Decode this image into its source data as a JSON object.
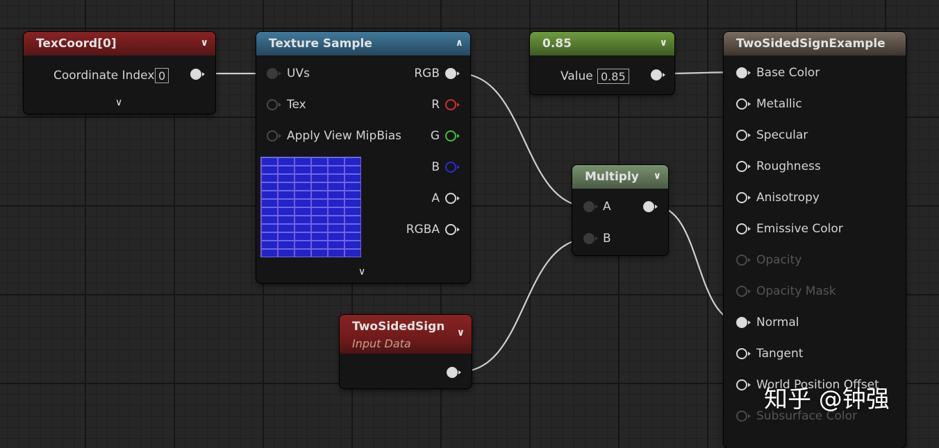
{
  "nodes": {
    "texcoord": {
      "title": "TexCoord[0]",
      "input_label": "Coordinate Index",
      "input_value": "0"
    },
    "texture_sample": {
      "title": "Texture Sample",
      "inputs": [
        "UVs",
        "Tex",
        "Apply View MipBias"
      ],
      "outputs": [
        "RGB",
        "R",
        "G",
        "B",
        "A",
        "RGBA"
      ]
    },
    "constant": {
      "title": "0.85",
      "value_label": "Value",
      "value": "0.85"
    },
    "multiply": {
      "title": "Multiply",
      "inputs": [
        "A",
        "B"
      ]
    },
    "two_sided_sign": {
      "title": "TwoSidedSign",
      "subtitle": "Input Data"
    },
    "material": {
      "title": "TwoSidedSignExample",
      "inputs": [
        "Base Color",
        "Metallic",
        "Specular",
        "Roughness",
        "Anisotropy",
        "Emissive Color",
        "Opacity",
        "Opacity Mask",
        "Normal",
        "Tangent",
        "World Position Offset",
        "Subsurface Color"
      ]
    }
  },
  "watermark": "知乎 @钟强",
  "colors": {
    "header_red": "#8a2222",
    "header_blue": "#3f7a9c",
    "header_green": "#6e9d3c",
    "header_sage": "#78926e",
    "header_tan": "#7a6c5e",
    "pin_r": "#d23030",
    "pin_g": "#3fc13f",
    "pin_b": "#2b2bd8"
  }
}
